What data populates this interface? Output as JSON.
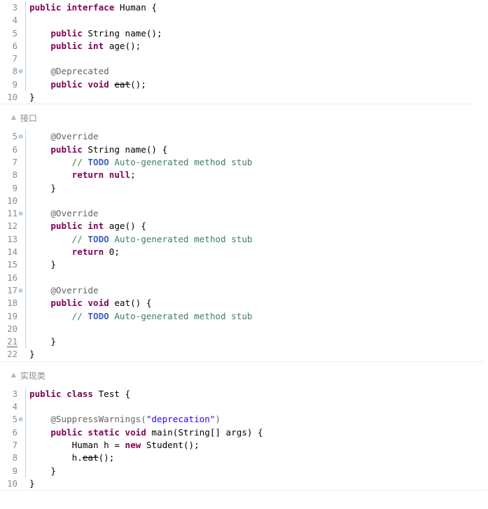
{
  "top_strip": {
    "name": "partial-table-strip",
    "cells": [
      "",
      "",
      "",
      "",
      ""
    ]
  },
  "blocks": [
    {
      "id": "interface-block",
      "caption": "接口",
      "caption_icon": "triangle-up-icon",
      "current_line": null,
      "lines": [
        {
          "num": "3",
          "fold": "",
          "code": [
            {
              "t": "kw",
              "v": "public interface"
            },
            {
              "t": "plain",
              "v": " Human {"
            }
          ]
        },
        {
          "num": "4",
          "fold": "",
          "code": [
            {
              "t": "plain",
              "v": ""
            }
          ]
        },
        {
          "num": "5",
          "fold": "",
          "code": [
            {
              "t": "plain",
              "v": "    "
            },
            {
              "t": "kw",
              "v": "public"
            },
            {
              "t": "plain",
              "v": " String name();"
            }
          ]
        },
        {
          "num": "6",
          "fold": "",
          "code": [
            {
              "t": "plain",
              "v": "    "
            },
            {
              "t": "kw",
              "v": "public int"
            },
            {
              "t": "plain",
              "v": " age();"
            }
          ]
        },
        {
          "num": "7",
          "fold": "",
          "code": [
            {
              "t": "plain",
              "v": ""
            }
          ]
        },
        {
          "num": "8",
          "fold": "⊖",
          "code": [
            {
              "t": "plain",
              "v": "    "
            },
            {
              "t": "ann",
              "v": "@Deprecated"
            }
          ]
        },
        {
          "num": "9",
          "fold": "",
          "code": [
            {
              "t": "plain",
              "v": "    "
            },
            {
              "t": "kw",
              "v": "public void"
            },
            {
              "t": "plain",
              "v": " "
            },
            {
              "t": "dep",
              "v": "eat"
            },
            {
              "t": "plain",
              "v": "();"
            }
          ]
        },
        {
          "num": "10",
          "fold": "",
          "code": [
            {
              "t": "plain",
              "v": "}"
            }
          ]
        }
      ]
    },
    {
      "id": "implementation-block",
      "caption": "实现类",
      "caption_icon": "triangle-up-icon",
      "current_line": "21",
      "lines": [
        {
          "num": "5",
          "fold": "⊖",
          "code": [
            {
              "t": "plain",
              "v": "    "
            },
            {
              "t": "ann",
              "v": "@Override"
            }
          ]
        },
        {
          "num": "6",
          "fold": "",
          "code": [
            {
              "t": "plain",
              "v": "    "
            },
            {
              "t": "kw",
              "v": "public"
            },
            {
              "t": "plain",
              "v": " String name() {"
            }
          ]
        },
        {
          "num": "7",
          "fold": "",
          "code": [
            {
              "t": "plain",
              "v": "        "
            },
            {
              "t": "cm",
              "v": "// "
            },
            {
              "t": "todo",
              "v": "TODO"
            },
            {
              "t": "cm",
              "v": " Auto-generated method stub"
            }
          ]
        },
        {
          "num": "8",
          "fold": "",
          "code": [
            {
              "t": "plain",
              "v": "        "
            },
            {
              "t": "kw",
              "v": "return null"
            },
            {
              "t": "plain",
              "v": ";"
            }
          ]
        },
        {
          "num": "9",
          "fold": "",
          "code": [
            {
              "t": "plain",
              "v": "    }"
            }
          ]
        },
        {
          "num": "10",
          "fold": "",
          "code": [
            {
              "t": "plain",
              "v": ""
            }
          ]
        },
        {
          "num": "11",
          "fold": "⊖",
          "code": [
            {
              "t": "plain",
              "v": "    "
            },
            {
              "t": "ann",
              "v": "@Override"
            }
          ]
        },
        {
          "num": "12",
          "fold": "",
          "code": [
            {
              "t": "plain",
              "v": "    "
            },
            {
              "t": "kw",
              "v": "public int"
            },
            {
              "t": "plain",
              "v": " age() {"
            }
          ]
        },
        {
          "num": "13",
          "fold": "",
          "code": [
            {
              "t": "plain",
              "v": "        "
            },
            {
              "t": "cm",
              "v": "// "
            },
            {
              "t": "todo",
              "v": "TODO"
            },
            {
              "t": "cm",
              "v": " Auto-generated method stub"
            }
          ]
        },
        {
          "num": "14",
          "fold": "",
          "code": [
            {
              "t": "plain",
              "v": "        "
            },
            {
              "t": "kw",
              "v": "return"
            },
            {
              "t": "plain",
              "v": " 0;"
            }
          ]
        },
        {
          "num": "15",
          "fold": "",
          "code": [
            {
              "t": "plain",
              "v": "    }"
            }
          ]
        },
        {
          "num": "16",
          "fold": "",
          "code": [
            {
              "t": "plain",
              "v": ""
            }
          ]
        },
        {
          "num": "17",
          "fold": "⊖",
          "code": [
            {
              "t": "plain",
              "v": "    "
            },
            {
              "t": "ann",
              "v": "@Override"
            }
          ]
        },
        {
          "num": "18",
          "fold": "",
          "code": [
            {
              "t": "plain",
              "v": "    "
            },
            {
              "t": "kw",
              "v": "public void"
            },
            {
              "t": "plain",
              "v": " eat() {"
            }
          ]
        },
        {
          "num": "19",
          "fold": "",
          "code": [
            {
              "t": "plain",
              "v": "        "
            },
            {
              "t": "cm",
              "v": "// "
            },
            {
              "t": "todo",
              "v": "TODO"
            },
            {
              "t": "cm",
              "v": " Auto-generated method stub"
            }
          ]
        },
        {
          "num": "20",
          "fold": "",
          "code": [
            {
              "t": "plain",
              "v": ""
            }
          ]
        },
        {
          "num": "21",
          "fold": "",
          "code": [
            {
              "t": "plain",
              "v": "    }"
            }
          ]
        },
        {
          "num": "22",
          "fold": "",
          "code": [
            {
              "t": "plain",
              "v": "}"
            }
          ]
        }
      ]
    },
    {
      "id": "test-class-block",
      "caption": null,
      "caption_icon": null,
      "current_line": null,
      "lines": [
        {
          "num": "3",
          "fold": "",
          "code": [
            {
              "t": "kw",
              "v": "public class"
            },
            {
              "t": "plain",
              "v": " Test {"
            }
          ]
        },
        {
          "num": "4",
          "fold": "",
          "code": [
            {
              "t": "plain",
              "v": ""
            }
          ]
        },
        {
          "num": "5",
          "fold": "⊖",
          "code": [
            {
              "t": "plain",
              "v": "    "
            },
            {
              "t": "ann",
              "v": "@SuppressWarnings("
            },
            {
              "t": "str",
              "v": "\"deprecation\""
            },
            {
              "t": "ann",
              "v": ")"
            }
          ]
        },
        {
          "num": "6",
          "fold": "",
          "code": [
            {
              "t": "plain",
              "v": "    "
            },
            {
              "t": "kw",
              "v": "public static void"
            },
            {
              "t": "plain",
              "v": " main(String[] args) {"
            }
          ]
        },
        {
          "num": "7",
          "fold": "",
          "code": [
            {
              "t": "plain",
              "v": "        Human h = "
            },
            {
              "t": "kw",
              "v": "new"
            },
            {
              "t": "plain",
              "v": " Student();"
            }
          ]
        },
        {
          "num": "8",
          "fold": "",
          "code": [
            {
              "t": "plain",
              "v": "        h."
            },
            {
              "t": "dep",
              "v": "eat"
            },
            {
              "t": "plain",
              "v": "();"
            }
          ]
        },
        {
          "num": "9",
          "fold": "",
          "code": [
            {
              "t": "plain",
              "v": "    }"
            }
          ]
        },
        {
          "num": "10",
          "fold": "",
          "code": [
            {
              "t": "plain",
              "v": "}"
            }
          ]
        }
      ]
    }
  ]
}
